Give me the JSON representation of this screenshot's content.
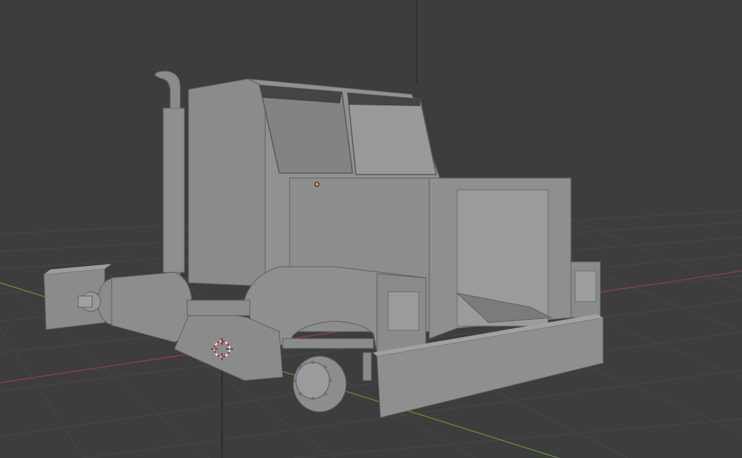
{
  "viewport": {
    "background": "#3d3d3d",
    "grid_color": "#4a4a4a",
    "x_axis_color": "#a33a45",
    "y_axis_color": "#6e9a2a",
    "z_axis_color": "#1e1e1e",
    "mesh_base_color": "#8a8c8c",
    "mesh_light_color": "#9a9c9c",
    "mesh_dark_color": "#6e7070",
    "window_color": "#4a4a4a",
    "origin_color": "#e8a020"
  },
  "scene": {
    "object": "truck-mesh",
    "icons": [
      "3d-cursor-icon",
      "object-origin-icon"
    ]
  }
}
